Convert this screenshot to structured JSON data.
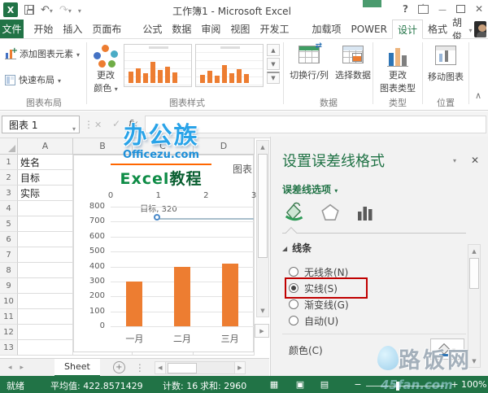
{
  "colors": {
    "accent": "#217346",
    "bar": "#ED7D31",
    "highlight": "#C00000",
    "watermark_blue": "#29A3E8"
  },
  "window": {
    "title": "工作簿1 - Microsoft Excel"
  },
  "tabs": {
    "file": "文件",
    "items": [
      "开始",
      "插入",
      "页面布",
      "公式",
      "数据",
      "审阅",
      "视图",
      "开发工",
      "加载项",
      "POWER",
      "设计",
      "格式"
    ],
    "active": "设计",
    "user": "胡俊"
  },
  "ribbon": {
    "add_chart_element": "添加图表元素",
    "quick_layout": "快速布局",
    "change_colors_1": "更改",
    "change_colors_2": "颜色",
    "switch_row_col": "切换行/列",
    "select_data": "选择数据",
    "change_type_1": "更改",
    "change_type_2": "图表类型",
    "move_chart": "移动图表",
    "groups": {
      "layout": "图表布局",
      "styles": "图表样式",
      "data": "数据",
      "type": "类型",
      "location": "位置"
    }
  },
  "formula_bar": {
    "name_box": "图表 1",
    "fx": "fx"
  },
  "sheet": {
    "columns": [
      "A",
      "B",
      "C",
      "D"
    ],
    "rows": [
      "1",
      "2",
      "3",
      "4",
      "5",
      "6",
      "7",
      "8",
      "9",
      "10",
      "11",
      "12",
      "13"
    ],
    "row_values": [
      "姓名",
      "目标",
      "实际"
    ],
    "tab_name": "Sheet"
  },
  "chart_data": {
    "type": "bar",
    "title": "图表",
    "categories": [
      "一月",
      "二月",
      "三月"
    ],
    "series": [
      {
        "name": "实际",
        "type": "bar",
        "values": [
          300,
          400,
          420
        ],
        "color": "#ED7D31"
      },
      {
        "name": "目标",
        "type": "line",
        "values": [
          320,
          320,
          320
        ],
        "color": "#A9BFCC",
        "marker_color": "#4A89C8"
      }
    ],
    "annotation": "目标, 320",
    "y_axis": {
      "min": 0,
      "max": 800,
      "step": 100,
      "ticks": [
        "800",
        "700",
        "600",
        "500",
        "400",
        "300",
        "200",
        "100",
        "0"
      ]
    },
    "secondary_x_axis": {
      "ticks": [
        "0",
        "1",
        "2",
        "3"
      ]
    },
    "grid": true,
    "legend": "none"
  },
  "watermark": {
    "brand": "办公族",
    "site": "Officezu.com",
    "tagline_en": "Excel",
    "tagline_cn": "教程",
    "footer_site": "路饭网",
    "footer_url": "45fan.com"
  },
  "pane": {
    "title": "设置误差线格式",
    "options_label": "误差线选项",
    "section_line": "线条",
    "radios": [
      {
        "label": "无线条(N)",
        "selected": false,
        "highlighted": false
      },
      {
        "label": "实线(S)",
        "selected": true,
        "highlighted": true
      },
      {
        "label": "渐变线(G)",
        "selected": false,
        "highlighted": false
      },
      {
        "label": "自动(U)",
        "selected": false,
        "highlighted": false
      }
    ],
    "color_label": "颜色(C)"
  },
  "status_bar": {
    "ready": "就绪",
    "average": "平均值: 422.8571429",
    "count": "计数: 16",
    "sum": "求和: 2960",
    "zoom": "100%"
  }
}
